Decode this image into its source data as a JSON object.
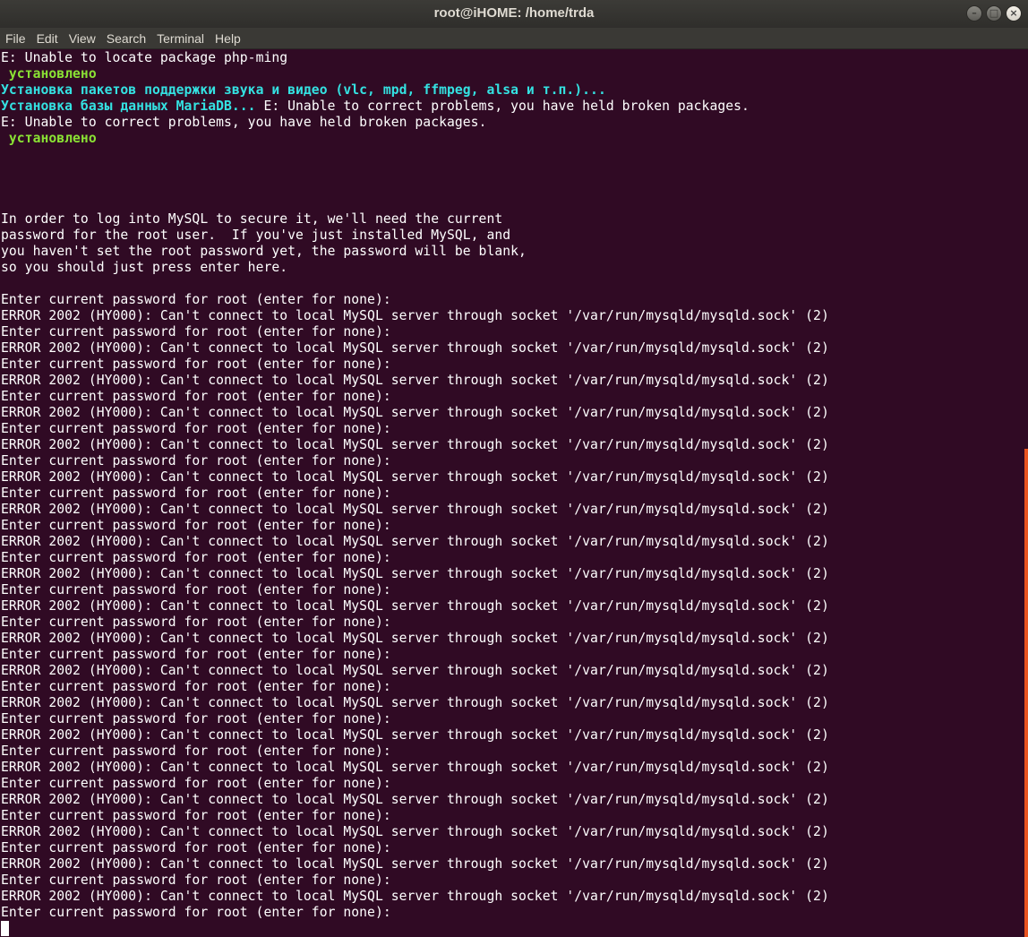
{
  "window": {
    "title": "root@iHOME: /home/trda"
  },
  "menu": [
    "File",
    "Edit",
    "View",
    "Search",
    "Terminal",
    "Help"
  ],
  "header_lines": [
    {
      "text": "E: Unable to locate package php-ming",
      "style": "plain"
    },
    {
      "text": " установлено",
      "style": "green"
    },
    {
      "text": "Установка пакетов поддержки звука и видео (vlc, mpd, ffmpeg, alsa и т.п.)...",
      "style": "cyan"
    },
    {
      "cyan": "Установка базы данных MariaDB... ",
      "text": "E: Unable to correct problems, you have held broken packages.",
      "style": "mixed"
    },
    {
      "text": "E: Unable to correct problems, you have held broken packages.",
      "style": "plain"
    },
    {
      "text": " установлено",
      "style": "green"
    },
    {
      "text": "",
      "style": "plain"
    },
    {
      "text": "",
      "style": "plain"
    },
    {
      "text": "",
      "style": "plain"
    },
    {
      "text": "",
      "style": "plain"
    },
    {
      "text": "In order to log into MySQL to secure it, we'll need the current",
      "style": "plain"
    },
    {
      "text": "password for the root user.  If you've just installed MySQL, and",
      "style": "plain"
    },
    {
      "text": "you haven't set the root password yet, the password will be blank,",
      "style": "plain"
    },
    {
      "text": "so you should just press enter here.",
      "style": "plain"
    },
    {
      "text": "",
      "style": "plain"
    }
  ],
  "prompt_line": "Enter current password for root (enter for none):",
  "error_line": "ERROR 2002 (HY000): Can't connect to local MySQL server through socket '/var/run/mysqld/mysqld.sock' (2)",
  "error_repeat_count": 19,
  "colors": {
    "background": "#300a24",
    "green": "#8ae234",
    "cyan": "#34e2e2",
    "scrollbar": "#e95420"
  }
}
